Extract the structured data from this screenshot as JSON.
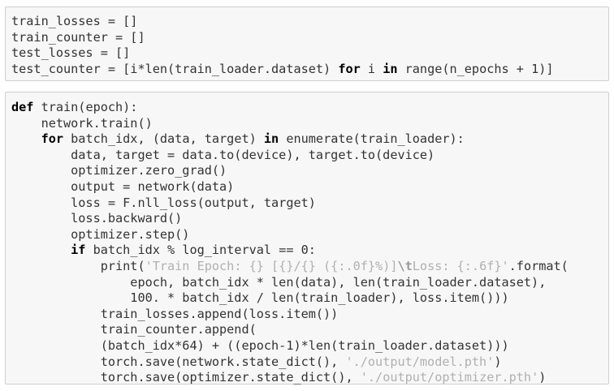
{
  "cells": [
    {
      "lines": [
        "train_losses = []",
        "train_counter = []",
        "test_losses = []",
        "test_counter = [i*len(train_loader.dataset) for i in range(n_epochs + 1)]"
      ]
    },
    {
      "lines": [
        "def train(epoch):",
        "    network.train()",
        "    for batch_idx, (data, target) in enumerate(train_loader):",
        "        data, target = data.to(device), target.to(device)",
        "        optimizer.zero_grad()",
        "        output = network(data)",
        "        loss = F.nll_loss(output, target)",
        "        loss.backward()",
        "        optimizer.step()",
        "        if batch_idx % log_interval == 0:",
        "            print('Train Epoch: {} [{}/{} ({:.0f}%)]\\tLoss: {:.6f}'.format(",
        "                epoch, batch_idx * len(data), len(train_loader.dataset),",
        "                100. * batch_idx / len(train_loader), loss.item()))",
        "            train_losses.append(loss.item())",
        "            train_counter.append(",
        "            (batch_idx*64) + ((epoch-1)*len(train_loader.dataset)))",
        "            torch.save(network.state_dict(), './output/model.pth')",
        "            torch.save(optimizer.state_dict(), './output/optimizer.pth')"
      ]
    }
  ],
  "colors": {
    "cell_background": "#f7f7f7",
    "cell_border": "#cfcfcf",
    "code_text": "#333333",
    "keyword": "#000000",
    "string": "#b0b0b0"
  }
}
